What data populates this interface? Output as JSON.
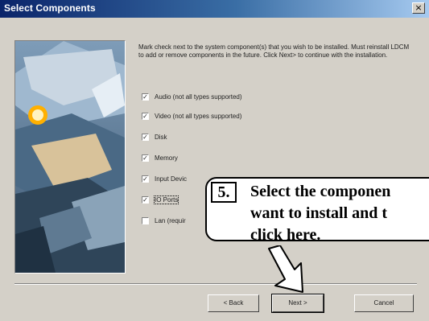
{
  "window": {
    "title": "Select Components",
    "close_glyph": "×"
  },
  "instructions": "Mark check next to the system component(s) that you wish to be installed. Must reinstall LDCM to add or remove components in the future. Click Next> to continue with the installation.",
  "components": [
    {
      "label": "Audio (not all types supported)",
      "checked": true
    },
    {
      "label": "Video (not all types supported)",
      "checked": true
    },
    {
      "label": "Disk",
      "checked": true
    },
    {
      "label": "Memory",
      "checked": true
    },
    {
      "label": "Input Devic",
      "checked": true
    },
    {
      "label": "IO Ports",
      "checked": true
    },
    {
      "label": "Lan (requir",
      "checked": false
    }
  ],
  "buttons": {
    "back": "< Back",
    "next": "Next >",
    "cancel": "Cancel"
  },
  "callout": {
    "step": "5.",
    "text": "Select the componen\nwant to install and t\nclick here."
  }
}
